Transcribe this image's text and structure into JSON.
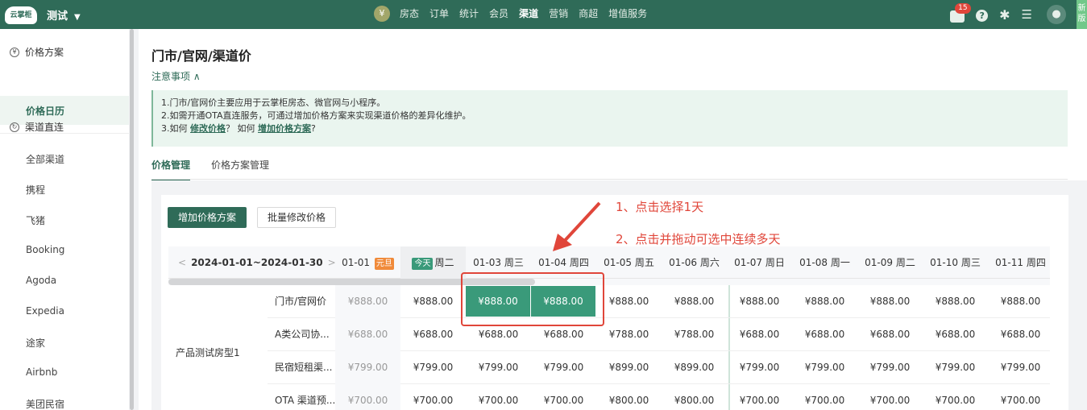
{
  "topbar": {
    "logo": "云掌柜",
    "store": "测试",
    "nav_items": [
      "房态",
      "订单",
      "统计",
      "会员",
      "渠道",
      "营销",
      "商超",
      "增值服务"
    ],
    "active_nav": "渠道",
    "message_count": "15",
    "new_tag": "新版"
  },
  "sidebar": {
    "group1": "价格方案",
    "active_item": "价格日历",
    "group2": "渠道直连",
    "channels": [
      "全部渠道",
      "携程",
      "飞猪",
      "Booking",
      "Agoda",
      "Expedia",
      "途家",
      "Airbnb",
      "美团民宿"
    ]
  },
  "main": {
    "title": "门市/官网/渠道价",
    "notice_toggle": "注意事项 ∧",
    "notice": {
      "line1": "1.门市/官网价主要应用于云掌柜房态、微官网与小程序。",
      "line2": "2.如需开通OTA直连服务，可通过增加价格方案来实现渠道价格的差异化维护。",
      "line3_a": "3.如何 ",
      "line3_link1": "修改价格",
      "line3_b": "？ 如何 ",
      "line3_link2": "增加价格方案",
      "line3_c": "?"
    },
    "tabs": [
      "价格管理",
      "价格方案管理"
    ],
    "buttons": {
      "add_plan": "增加价格方案",
      "batch_edit": "批量修改价格"
    }
  },
  "grid": {
    "range": "2024-01-01~2024-01-30",
    "dates": [
      {
        "date": "01-01",
        "tag": "元旦"
      },
      {
        "date": "",
        "today": "今天",
        "weekday": "周二"
      },
      {
        "date": "01-03",
        "weekday": "周三"
      },
      {
        "date": "01-04",
        "weekday": "周四"
      },
      {
        "date": "01-05",
        "weekday": "周五"
      },
      {
        "date": "01-06",
        "weekday": "周六"
      },
      {
        "date": "01-07",
        "weekday": "周日"
      },
      {
        "date": "01-08",
        "weekday": "周一"
      },
      {
        "date": "01-09",
        "weekday": "周二"
      },
      {
        "date": "01-10",
        "weekday": "周三"
      },
      {
        "date": "01-11",
        "weekday": "周四"
      }
    ],
    "room_type": "产品测试房型1",
    "rows": [
      {
        "label": "门市/官网价",
        "prices": [
          "¥888.00",
          "¥888.00",
          "¥888.00",
          "¥888.00",
          "¥888.00",
          "¥888.00",
          "¥888.00",
          "¥888.00",
          "¥888.00",
          "¥888.00",
          "¥888.00"
        ]
      },
      {
        "label": "A类公司协...",
        "prices": [
          "¥688.00",
          "¥688.00",
          "¥688.00",
          "¥688.00",
          "¥788.00",
          "¥788.00",
          "¥688.00",
          "¥688.00",
          "¥688.00",
          "¥688.00",
          "¥688.00"
        ]
      },
      {
        "label": "民宿短租渠...",
        "prices": [
          "¥799.00",
          "¥799.00",
          "¥799.00",
          "¥799.00",
          "¥899.00",
          "¥899.00",
          "¥799.00",
          "¥799.00",
          "¥799.00",
          "¥799.00",
          "¥799.00"
        ]
      },
      {
        "label": "OTA 渠道预...",
        "prices": [
          "¥700.00",
          "¥700.00",
          "¥700.00",
          "¥700.00",
          "¥800.00",
          "¥800.00",
          "¥700.00",
          "¥700.00",
          "¥700.00",
          "¥700.00",
          "¥700.00"
        ]
      }
    ]
  },
  "annotations": {
    "a1": "1、点击选择1天",
    "a2": "2、点击并拖动可选中连续多天"
  },
  "colors": {
    "brand": "#2f6b58",
    "selected": "#3a9a7a",
    "annotation": "#e0463a"
  }
}
